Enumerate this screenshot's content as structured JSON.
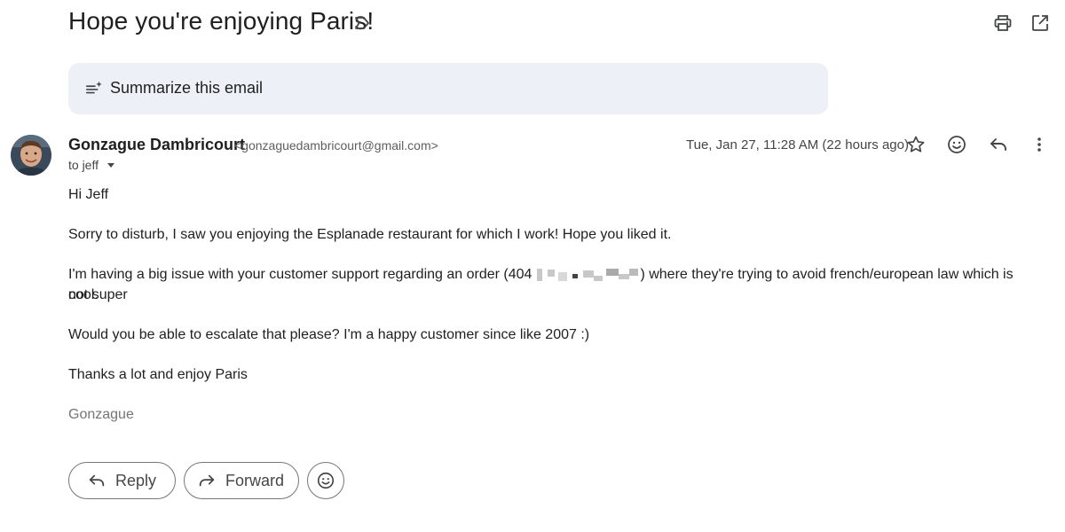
{
  "email": {
    "subject": "Hope you're enjoying Paris!",
    "summarize_label": "Summarize this email",
    "sender_name": "Gonzague Dambricourt",
    "sender_email": "<gonzaguedambricourt@gmail.com>",
    "to_line": "to jeff",
    "date": "Tue, Jan 27, 11:28 AM (22 hours ago)",
    "body": {
      "greeting": "Hi Jeff",
      "p1": "Sorry to disturb, I saw you enjoying the Esplanade restaurant for which I work! Hope you liked it.",
      "p2_before": "I'm having a big issue with your customer support regarding an order (404",
      "p2_after": ") where they're trying to avoid french/european law which is not super",
      "p2_cont": "cool.",
      "p3": "Would you be able to escalate that please? I'm a happy customer since like 2007 :)",
      "p4": "Thanks a lot and enjoy Paris",
      "signature": "Gonzague"
    }
  },
  "actions": {
    "reply_label": "Reply",
    "forward_label": "Forward"
  },
  "icons": {
    "label": "label-icon",
    "print": "print-icon",
    "open_new_window": "open-in-new-icon",
    "summarize": "sparkle-lines-icon",
    "star": "star-icon",
    "emoji": "emoji-icon",
    "reply": "reply-icon",
    "more": "more-vert-icon",
    "forward": "forward-icon",
    "dropdown": "chevron-down-icon"
  },
  "colors": {
    "summarize_bg": "#edf1f7",
    "text_primary": "#1f1f1f",
    "text_secondary": "#444746",
    "signature": "#757575"
  }
}
